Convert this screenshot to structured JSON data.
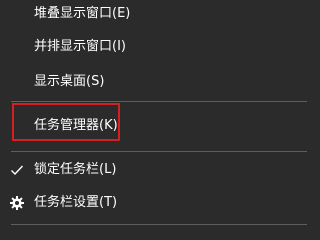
{
  "menu": {
    "items": [
      {
        "label": "堆叠显示窗口(E)",
        "icon": ""
      },
      {
        "label": "并排显示窗口(I)",
        "icon": ""
      },
      {
        "label": "显示桌面(S)",
        "icon": ""
      },
      {
        "label": "任务管理器(K)",
        "icon": ""
      },
      {
        "label": "锁定任务栏(L)",
        "icon": "check-icon"
      },
      {
        "label": "任务栏设置(T)",
        "icon": "gear-icon"
      }
    ]
  },
  "colors": {
    "background": "#2b2b2b",
    "text": "#ffffff",
    "separator": "#5f5f5f",
    "highlight_box": "#d61f1f"
  }
}
